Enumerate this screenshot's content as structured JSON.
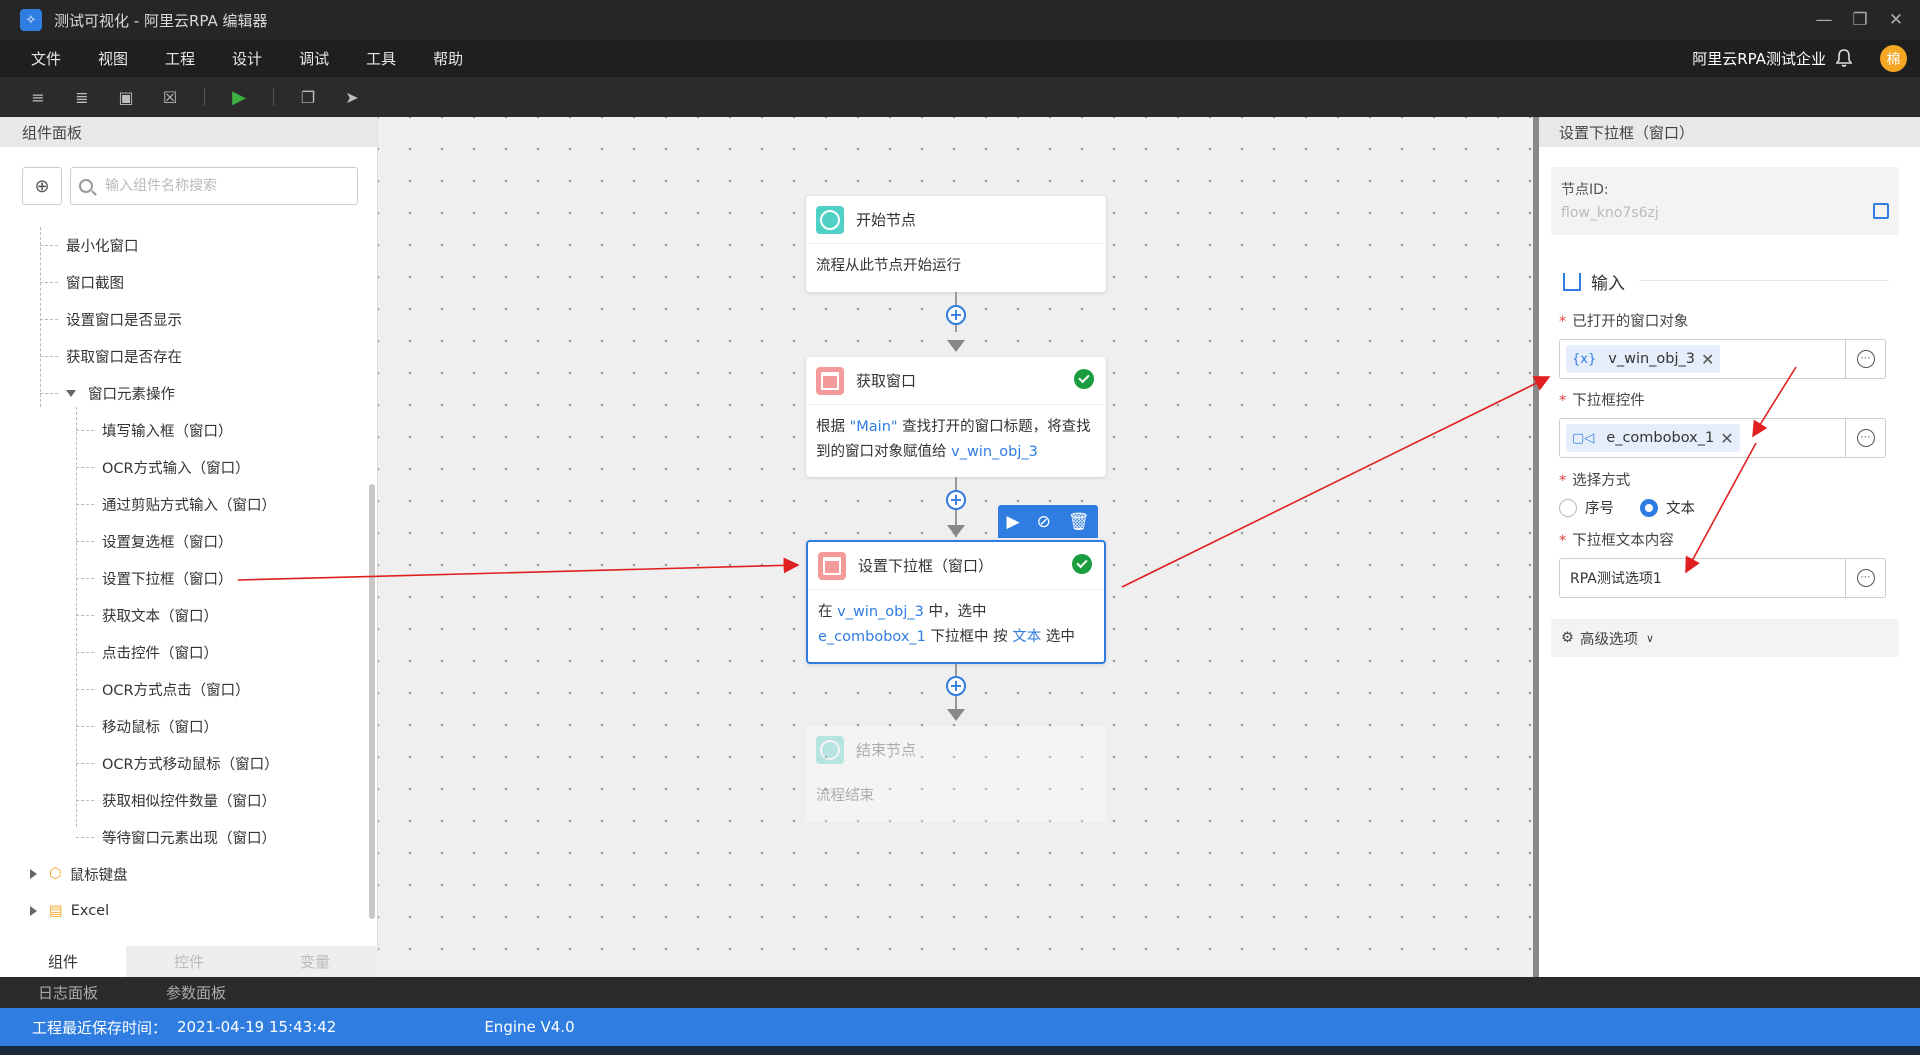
{
  "window": {
    "title": "测试可视化 - 阿里云RPA 编辑器",
    "logo_icon": "rpa-logo-icon"
  },
  "menu": [
    "文件",
    "视图",
    "工程",
    "设计",
    "调试",
    "工具",
    "帮助"
  ],
  "header": {
    "company": "阿里云RPA测试企业",
    "avatar_text": "棉"
  },
  "left_panel": {
    "title": "组件面板",
    "search_placeholder": "输入组件名称搜索",
    "items": [
      "最小化窗口",
      "窗口截图",
      "设置窗口是否显示",
      "获取窗口是否存在"
    ],
    "group_label": "窗口元素操作",
    "sub_items": [
      "填写输入框（窗口）",
      "OCR方式输入（窗口）",
      "通过剪贴方式输入（窗口）",
      "设置复选框（窗口）",
      "设置下拉框（窗口）",
      "获取文本（窗口）",
      "点击控件（窗口）",
      "OCR方式点击（窗口）",
      "移动鼠标（窗口）",
      "OCR方式移动鼠标（窗口）",
      "获取相似控件数量（窗口）",
      "等待窗口元素出现（窗口）"
    ],
    "categories": [
      "鼠标键盘",
      "Excel"
    ],
    "tabs": [
      "组件",
      "控件",
      "变量"
    ]
  },
  "canvas": {
    "nodes": [
      {
        "title": "开始节点",
        "body": "流程从此节点开始运行"
      },
      {
        "title": "获取窗口",
        "body_parts": [
          "根据 ",
          "\"Main\"",
          " 查找打开的窗口标题，将查找到的窗口对象赋值给 ",
          "v_win_obj_3"
        ]
      },
      {
        "title": "设置下拉框（窗口）",
        "body_parts": [
          "在 ",
          "v_win_obj_3",
          " 中，选中 ",
          "e_combobox_1",
          " 下拉框中 按 ",
          "文本",
          " 选中"
        ]
      },
      {
        "title": "结束节点",
        "body": "流程结束"
      }
    ]
  },
  "right_panel": {
    "title": "设置下拉框（窗口）",
    "node_id_label": "节点ID:",
    "node_id": "flow_kno7s6zj",
    "input_section": "输入",
    "fields": {
      "window_label": "已打开的窗口对象",
      "window_value": "v_win_obj_3",
      "window_icon_text": "{x}",
      "combo_label": "下拉框控件",
      "combo_value": "e_combobox_1",
      "method_label": "选择方式",
      "method_options": [
        "序号",
        "文本"
      ],
      "method_selected": "文本",
      "text_label": "下拉框文本内容",
      "text_value": "RPA测试选项1"
    },
    "advanced": "高级选项"
  },
  "bottom": {
    "tabs": [
      "日志面板",
      "参数面板"
    ],
    "save_time_label": "工程最近保存时间：",
    "save_time": "2021-04-19 15:43:42",
    "engine": "Engine V4.0"
  },
  "colors": {
    "accent": "#2f7de1",
    "success": "#1a9d3f",
    "annotation": "#e02020"
  }
}
